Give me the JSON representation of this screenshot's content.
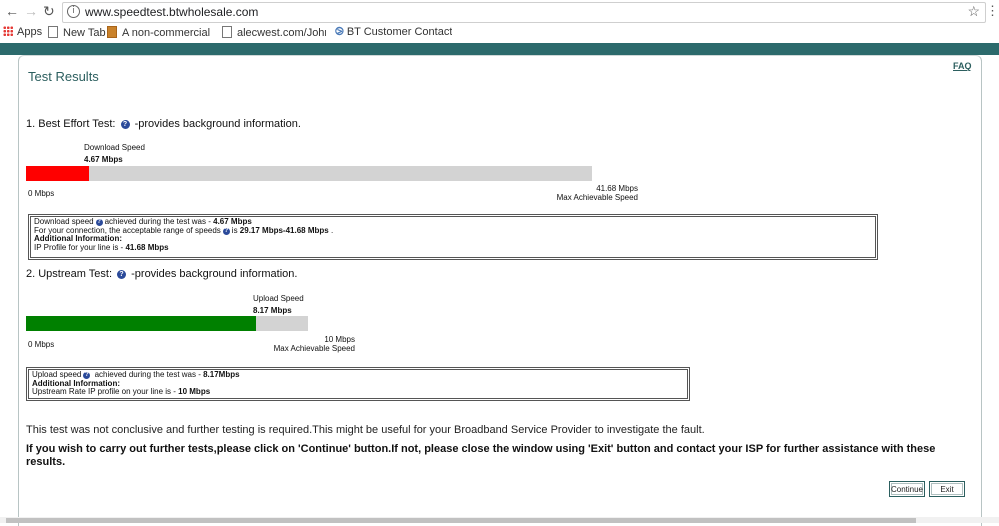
{
  "browser": {
    "url": "www.speedtest.btwholesale.com",
    "bookmarks": [
      {
        "label": "Apps",
        "icon": "apps-grid-icon"
      },
      {
        "label": "New Tab",
        "icon": "page-icon"
      },
      {
        "label": "A non-commercial se",
        "icon": "bookmark-image-icon"
      },
      {
        "label": "alecwest.com/JohnTit",
        "icon": "page-icon"
      },
      {
        "label": "BT Customer Contact",
        "icon": "bt-icon"
      }
    ]
  },
  "page": {
    "title": "Test Results",
    "faq": "FAQ"
  },
  "download_test": {
    "heading_prefix": "1. Best Effort Test:",
    "heading_suffix": "-provides background information.",
    "speed_label": "Download Speed",
    "speed_value": "4.67 Mbps",
    "min_label": "0 Mbps",
    "max_value": "41.68 Mbps",
    "max_label": "Max Achievable Speed",
    "fill_fraction": 0.112,
    "fill_color": "#ff0000",
    "info": {
      "line1_prefix": "Download speed",
      "line1_mid": "achieved during the test was - ",
      "line1_value": "4.67 Mbps",
      "line2_prefix": "For your connection, the acceptable range of speeds",
      "line2_mid": "is ",
      "line2_value": "29.17 Mbps-41.68 Mbps",
      "line2_end": " .",
      "additional": "Additional Information:",
      "line4_prefix": "IP Profile for your line is - ",
      "line4_value": "41.68 Mbps"
    }
  },
  "upload_test": {
    "heading_prefix": "2. Upstream Test:",
    "heading_suffix": "-provides background information.",
    "speed_label": "Upload Speed",
    "speed_value": "8.17 Mbps",
    "min_label": "0 Mbps",
    "max_value": "10 Mbps",
    "max_label": "Max Achievable Speed",
    "fill_fraction": 0.817,
    "fill_color": "#008000",
    "info": {
      "line1_prefix": "Upload speed",
      "line1_mid": " achieved during the test was - ",
      "line1_value": "8.17Mbps",
      "additional": "Additional Information:",
      "line3_prefix": "Upstream Rate IP profile on your line is - ",
      "line3_value": "10 Mbps"
    }
  },
  "note": "This test was not conclusive and further testing is required.This might be useful for your Broadband Service Provider to investigate the fault.",
  "instruction": "If you wish to carry out further tests,please click on 'Continue' button.If not, please close the window using 'Exit' button and contact your ISP for further assistance with these results.",
  "buttons": {
    "continue": "Continue",
    "exit": "Exit"
  },
  "colors": {
    "teal": "#2c6a6c",
    "title": "#2c5f5f",
    "help_icon": "#2b4a9a"
  }
}
